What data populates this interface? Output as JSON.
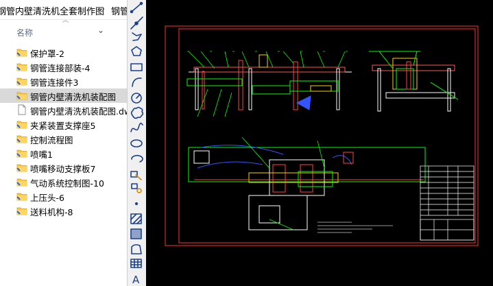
{
  "breadcrumb": {
    "items": [
      "钢管内壁清洗机全套制作图",
      "钢管"
    ],
    "separator": "›"
  },
  "header": {
    "name_column": "名称"
  },
  "files": [
    {
      "name": "保护罩-2",
      "type": "folder",
      "selected": false
    },
    {
      "name": "钢管连接部装-4",
      "type": "folder",
      "selected": false
    },
    {
      "name": "钢管连接件3",
      "type": "folder",
      "selected": false
    },
    {
      "name": "钢管内壁清洗机装配图",
      "type": "folder",
      "selected": true
    },
    {
      "name": "钢管内壁清洗机装配图.dwg",
      "type": "file",
      "selected": false
    },
    {
      "name": "夹紧装置支撑座5",
      "type": "folder",
      "selected": false
    },
    {
      "name": "控制流程图",
      "type": "folder",
      "selected": false
    },
    {
      "name": "喷嘴1",
      "type": "folder",
      "selected": false
    },
    {
      "name": "喷嘴移动支撑板7",
      "type": "folder",
      "selected": false
    },
    {
      "name": "气动系统控制图-10",
      "type": "folder",
      "selected": false
    },
    {
      "name": "上压头-6",
      "type": "folder",
      "selected": false
    },
    {
      "name": "送料机构-8",
      "type": "folder",
      "selected": false
    }
  ],
  "toolbar": {
    "tools": [
      "line-tool-icon",
      "construction-line-tool-icon",
      "polyline-tool-icon",
      "polygon-tool-icon",
      "rectangle-tool-icon",
      "arc-tool-icon",
      "circle-tool-icon",
      "revision-cloud-tool-icon",
      "spline-tool-icon",
      "ellipse-tool-icon",
      "ellipse-arc-tool-icon",
      "insert-block-tool-icon",
      "make-block-tool-icon",
      "point-tool-icon",
      "hatch-tool-icon",
      "gradient-tool-icon",
      "region-tool-icon",
      "table-tool-icon",
      "multiline-text-tool-icon"
    ],
    "text_tool_glyph": "A"
  },
  "colors": {
    "canvas": "#000000",
    "frame": "#ff3030",
    "cad_green": "#00ff00",
    "cad_red": "#ff2020",
    "cad_blue": "#3355ff",
    "cad_white": "#ffffff",
    "folder": "#f5c242",
    "selection": "#d9d9d9"
  }
}
